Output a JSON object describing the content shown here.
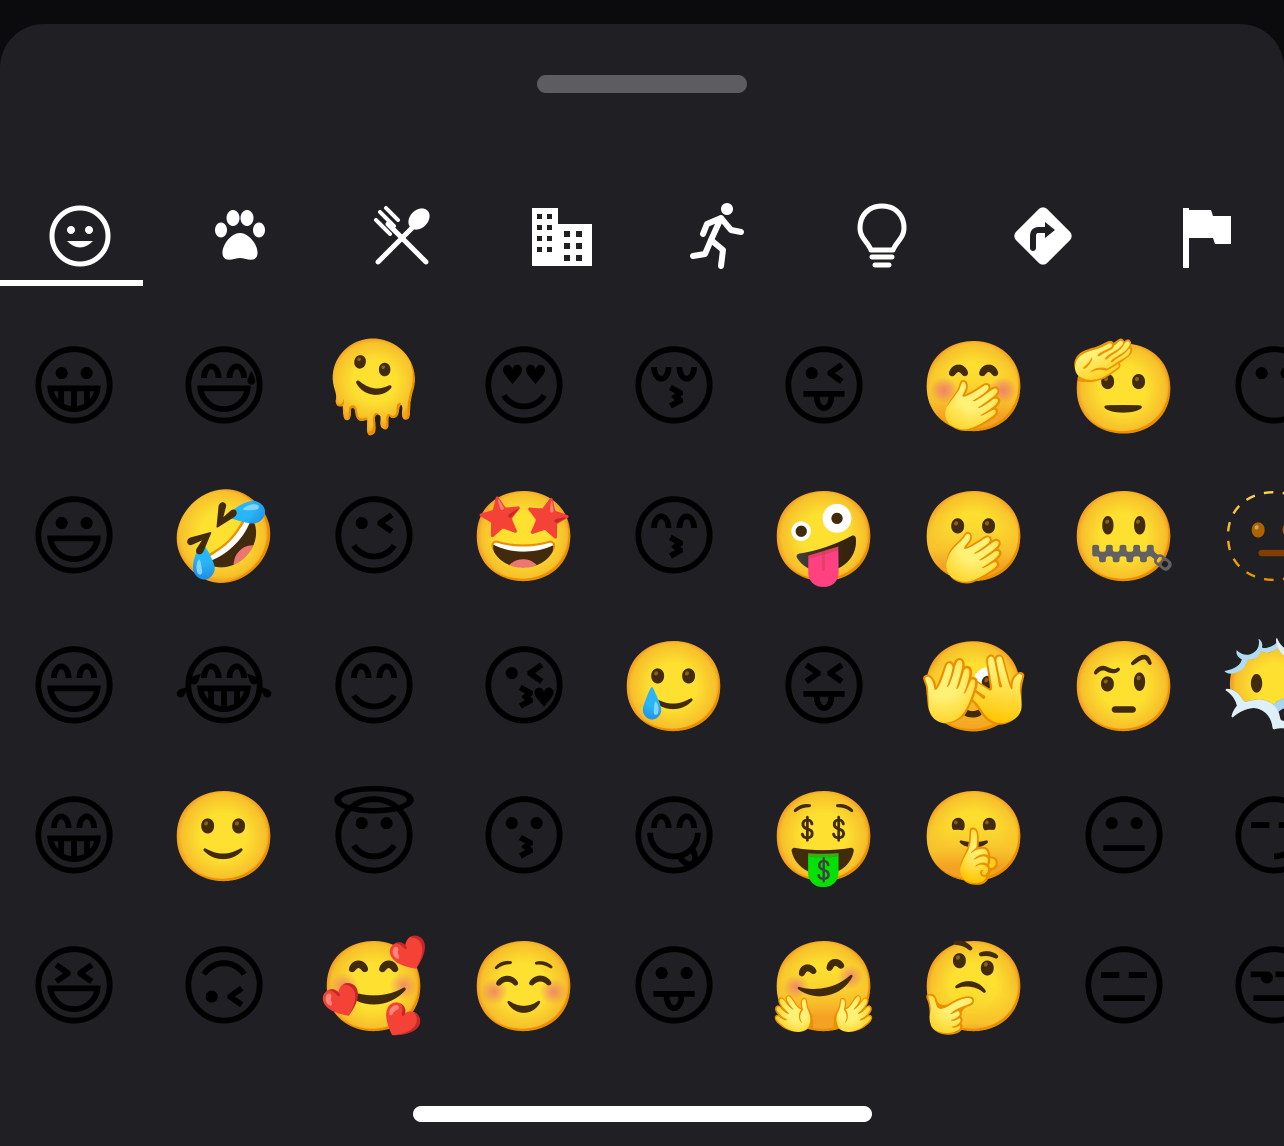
{
  "sheet": {
    "title": "",
    "accent_color": "#ffffff",
    "background_color": "#202024"
  },
  "categories": [
    {
      "name": "smileys-and-people",
      "icon": "smiley-face-icon",
      "selected": true
    },
    {
      "name": "animals-and-nature",
      "icon": "paw-icon",
      "selected": false
    },
    {
      "name": "food-and-drink",
      "icon": "fork-and-spoon-icon",
      "selected": false
    },
    {
      "name": "travel-and-places",
      "icon": "building-icon",
      "selected": false
    },
    {
      "name": "activity",
      "icon": "running-person-icon",
      "selected": false
    },
    {
      "name": "objects",
      "icon": "lightbulb-icon",
      "selected": false
    },
    {
      "name": "symbols",
      "icon": "direction-sign-icon",
      "selected": false
    },
    {
      "name": "flags",
      "icon": "flag-icon",
      "selected": false
    }
  ],
  "emoji_grid": {
    "columns": [
      [
        "😀",
        "😃",
        "😄",
        "😁",
        "😆"
      ],
      [
        "😅",
        "🤣",
        "😂",
        "🙂",
        "🙃"
      ],
      [
        "🫠",
        "😉",
        "😊",
        "😇",
        "🥰"
      ],
      [
        "😍",
        "🤩",
        "😘",
        "😗",
        "☺️"
      ],
      [
        "😚",
        "😙",
        "🥲",
        "😋",
        "😛"
      ],
      [
        "😜",
        "🤪",
        "😝",
        "🤑",
        "🤗"
      ],
      [
        "🤭",
        "🫢",
        "🫣",
        "🤫",
        "🤔"
      ],
      [
        "🫡",
        "🤐",
        "🤨",
        "😐",
        "😑"
      ],
      [
        "😶",
        "🫥",
        "😶‍🌫️",
        "😏",
        "😒"
      ]
    ]
  }
}
